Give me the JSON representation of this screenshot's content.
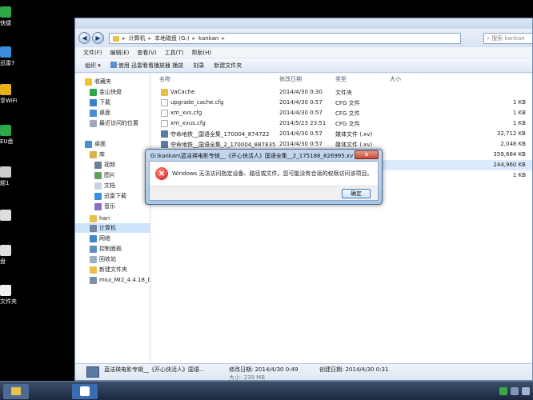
{
  "desktop": {
    "icons": [
      {
        "label": "快捷",
        "color": "#2aa84a"
      },
      {
        "label": "迅雷7",
        "color": "#3b8de0"
      },
      {
        "label": "享WiFi",
        "color": "#e8b21c"
      },
      {
        "label": "EU盘",
        "color": "#2aa84a"
      },
      {
        "label": "题1",
        "color": "#cccccc"
      },
      {
        "label": "",
        "color": "#dddddd"
      },
      {
        "label": "盘",
        "color": "#e0e0e0"
      },
      {
        "label": "文件夹",
        "color": "#f1f1f1"
      }
    ]
  },
  "window": {
    "breadcrumb": [
      "计算机",
      "本地磁盘 (G:)",
      "kankan"
    ],
    "search_placeholder": "搜索 kankan",
    "menu": [
      "文件(F)",
      "编辑(E)",
      "查看(V)",
      "工具(T)",
      "帮助(H)"
    ],
    "toolbar": {
      "organize": "组织 ▾",
      "open_with": "使用 迅雷看看播放器 播放",
      "burn": "刻录",
      "new_folder": "新建文件夹"
    },
    "nav": {
      "favorites": "收藏夹",
      "fav_items": [
        "金山快盘",
        "下载",
        "桌面",
        "最近访问的位置"
      ],
      "desktop": "桌面",
      "library": "库",
      "lib_items": [
        "视频",
        "图片",
        "文档",
        "迅雷下载",
        "音乐"
      ],
      "han": "han",
      "computer": "计算机",
      "network": "网络",
      "control_panel": "控制面板",
      "recycle": "回收站",
      "new_folder": "新建文件夹",
      "miui": "miui_MI2_4.4.18_b"
    },
    "columns": {
      "name": "名称",
      "date": "修改日期",
      "type": "类型",
      "size": "大小"
    },
    "files": [
      {
        "name": "VaCache",
        "date": "2014/4/30 0:30",
        "type": "文件夹",
        "size": "",
        "color": "#e8c04a"
      },
      {
        "name": "upgrade_cache.cfg",
        "date": "2014/4/30 0:57",
        "type": "CFG 文件",
        "size": "1 KB",
        "color": "#ffffff"
      },
      {
        "name": "xm_xvs.cfg",
        "date": "2014/4/30 0:57",
        "type": "CFG 文件",
        "size": "1 KB",
        "color": "#ffffff"
      },
      {
        "name": "xm_xvus.cfg",
        "date": "2014/5/23 23:51",
        "type": "CFG 文件",
        "size": "1 KB",
        "color": "#ffffff"
      },
      {
        "name": "夺命地铁__国语全集_170004_874722",
        "date": "2014/4/30 0:57",
        "type": "媒体文件 (.xv)",
        "size": "32,712 KB",
        "color": "#5d7aa3"
      },
      {
        "name": "夺命地铁__国语全集_2_170004_887835",
        "date": "2014/4/30 0:57",
        "type": "媒体文件 (.xv)",
        "size": "2,048 KB",
        "color": "#5d7aa3"
      },
      {
        "name": "",
        "date": "",
        "type": "",
        "size": "359,684 KB",
        "color": "#5d7aa3"
      },
      {
        "name": "",
        "date": "",
        "type": "",
        "size": "244,960 KB",
        "color": "#5d7aa3"
      },
      {
        "name": "",
        "date": "",
        "type": "",
        "size": "1 KB",
        "color": "#ffffff"
      }
    ],
    "details": {
      "name": "蓝洁瑛电影专辑__《开心快活人》国语...",
      "modified": "修改日期: 2014/4/30 0:49",
      "created": "创建日期: 2014/4/30 0:31",
      "size_partial": "大小: 239 MB"
    }
  },
  "dialog": {
    "title": "G:\\kankan\\蓝洁瑛电影专辑__《开心快活人》国语全集__2_175188_826995.xv",
    "close": "✕",
    "message": "Windows 无法访问指定设备、路径或文件。您可能没有合适的权限访问该项目。",
    "ok": "确定"
  },
  "colors": {
    "accent": "#3c7fb1",
    "error": "#c8171a",
    "folder": "#e8c04a"
  }
}
